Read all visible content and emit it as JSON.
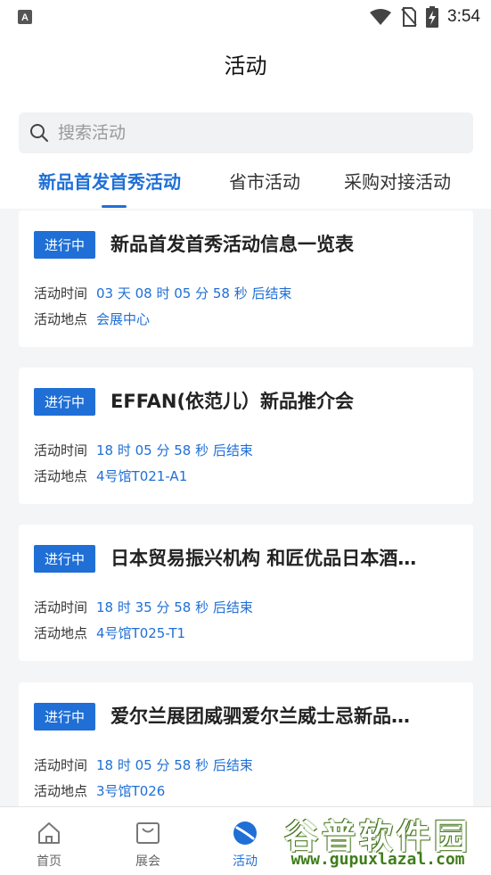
{
  "status_bar": {
    "time": "3:54"
  },
  "header": {
    "title": "活动"
  },
  "search": {
    "placeholder": "搜索活动"
  },
  "tabs": [
    {
      "label": "新品首发首秀活动",
      "active": true
    },
    {
      "label": "省市活动",
      "active": false
    },
    {
      "label": "采购对接活动",
      "active": false
    }
  ],
  "cards": [
    {
      "badge": "进行中",
      "title": "新品首发首秀活动信息一览表",
      "time_label": "活动时间",
      "time_value": "03 天 08 时 05 分 58 秒 后结束",
      "place_label": "活动地点",
      "place_value": "会展中心"
    },
    {
      "badge": "进行中",
      "title": "EFFAN(依范儿）新品推介会",
      "time_label": "活动时间",
      "time_value": "18 时 05 分 58 秒 后结束",
      "place_label": "活动地点",
      "place_value": "4号馆T021-A1"
    },
    {
      "badge": "进行中",
      "title": "日本贸易振兴机构 和匠优品日本酒…",
      "time_label": "活动时间",
      "time_value": "18 时 35 分 58 秒 后结束",
      "place_label": "活动地点",
      "place_value": "4号馆T025-T1"
    },
    {
      "badge": "进行中",
      "title": "爱尔兰展团威驷爱尔兰威士忌新品…",
      "time_label": "活动时间",
      "time_value": "18 时 05 分 58 秒 后结束",
      "place_label": "活动地点",
      "place_value": "3号馆T026"
    }
  ],
  "bottom_nav": [
    {
      "label": "首页",
      "icon": "home-icon",
      "active": false
    },
    {
      "label": "展会",
      "icon": "bag-icon",
      "active": false
    },
    {
      "label": "活动",
      "icon": "activity-icon",
      "active": true
    }
  ],
  "watermark": {
    "title": "谷普软件园",
    "url": "www.gupuxlazal.com"
  },
  "colors": {
    "accent": "#1f6fd6",
    "background": "#f4f5f7"
  }
}
